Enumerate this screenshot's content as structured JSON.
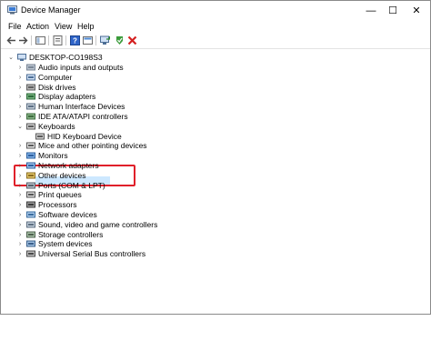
{
  "window": {
    "title": "Device Manager",
    "minimize_glyph": "—",
    "maximize_glyph": "☐",
    "close_glyph": "✕"
  },
  "menu": {
    "file": "File",
    "action": "Action",
    "view": "View",
    "help": "Help"
  },
  "toolbar": {
    "back_glyph": "🡐",
    "forward_glyph": "🡒"
  },
  "tree": {
    "root": "DESKTOP-CO198S3",
    "items": [
      {
        "label": "Audio inputs and outputs",
        "icon": "speaker-icon"
      },
      {
        "label": "Computer",
        "icon": "computer-icon"
      },
      {
        "label": "Disk drives",
        "icon": "disk-drive-icon"
      },
      {
        "label": "Display adapters",
        "icon": "display-adapter-icon"
      },
      {
        "label": "Human Interface Devices",
        "icon": "hid-icon"
      },
      {
        "label": "IDE ATA/ATAPI controllers",
        "icon": "ide-controller-icon"
      },
      {
        "label": "Keyboards",
        "icon": "keyboard-icon",
        "expanded": true
      },
      {
        "label": "HID Keyboard Device",
        "icon": "keyboard-icon",
        "child": true,
        "selected": true
      },
      {
        "label": "Mice and other pointing devices",
        "icon": "mouse-icon"
      },
      {
        "label": "Monitors",
        "icon": "monitor-icon"
      },
      {
        "label": "Network adapters",
        "icon": "network-adapter-icon"
      },
      {
        "label": "Other devices",
        "icon": "other-devices-icon"
      },
      {
        "label": "Ports (COM & LPT)",
        "icon": "port-icon"
      },
      {
        "label": "Print queues",
        "icon": "printer-icon"
      },
      {
        "label": "Processors",
        "icon": "processor-icon"
      },
      {
        "label": "Software devices",
        "icon": "software-device-icon"
      },
      {
        "label": "Sound, video and game controllers",
        "icon": "sound-icon"
      },
      {
        "label": "Storage controllers",
        "icon": "storage-controller-icon"
      },
      {
        "label": "System devices",
        "icon": "system-device-icon"
      },
      {
        "label": "Universal Serial Bus controllers",
        "icon": "usb-icon"
      }
    ]
  },
  "colors": {
    "highlight_border": "#e0202a",
    "selection": "#cde8ff"
  }
}
